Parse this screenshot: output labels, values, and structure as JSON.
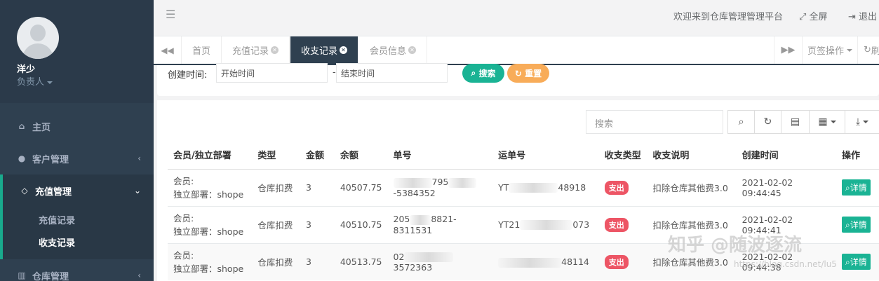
{
  "user": {
    "name": "洋少",
    "role": "负责人"
  },
  "sidebar": {
    "items": [
      {
        "label": "主页",
        "icon": "home-icon"
      },
      {
        "label": "客户管理",
        "icon": "user-icon"
      },
      {
        "label": "充值管理",
        "icon": "diamond-icon"
      },
      {
        "label": "仓库管理",
        "icon": "bank-icon"
      }
    ],
    "sub_items": [
      {
        "label": "充值记录"
      },
      {
        "label": "收支记录"
      }
    ]
  },
  "header": {
    "welcome": "欢迎来到仓库管理管理平台",
    "fullscreen": "全屏",
    "logout": "退出"
  },
  "tabs": [
    {
      "label": "首页"
    },
    {
      "label": "充值记录"
    },
    {
      "label": "收支记录",
      "active": true
    },
    {
      "label": "会员信息"
    }
  ],
  "tab_ops": {
    "label": "页签操作",
    "refresh": "刷"
  },
  "filter": {
    "label": "创建时间:",
    "start_placeholder": "开始时间",
    "end_placeholder": "结束时间",
    "dash": "-",
    "search_label": "搜索",
    "reset_label": "重置"
  },
  "table": {
    "search_placeholder": "搜索",
    "columns": [
      "会员/独立部署",
      "类型",
      "金额",
      "余额",
      "单号",
      "运单号",
      "收支类型",
      "收支说明",
      "创建时间",
      "操作"
    ],
    "rows": [
      {
        "member_line1": "会员:",
        "member_line2": "独立部署：shope",
        "type": "仓库扣费",
        "amount": "3",
        "balance": "40507.75",
        "order_prefix": "",
        "order_mid": "795",
        "order_suffix": "-5384352",
        "waybill_prefix": "YT",
        "waybill_suffix": "48918",
        "flow_type": "支出",
        "desc": "扣除仓库其他费3.0",
        "created": "2021-02-02 09:44:45",
        "action": "详情"
      },
      {
        "member_line1": "会员:",
        "member_line2": "独立部署：shope",
        "type": "仓库扣费",
        "amount": "3",
        "balance": "40510.75",
        "order_prefix": "205",
        "order_mid": "8821",
        "order_suffix": "-8311531",
        "waybill_prefix": "YT21",
        "waybill_suffix": "073",
        "flow_type": "支出",
        "desc": "扣除仓库其他费3.0",
        "created": "2021-02-02 09:44:41",
        "action": "详情"
      },
      {
        "member_line1": "会员:",
        "member_line2": "独立部署：shope",
        "type": "仓库扣费",
        "amount": "3",
        "balance": "40513.75",
        "order_prefix": "02",
        "order_mid": "",
        "order_suffix": "3572363",
        "waybill_prefix": "",
        "waybill_suffix": "48114",
        "flow_type": "支出",
        "desc": "扣除仓库其他费3.0",
        "created": "2021-02-02 09:44:38",
        "action": "详情"
      }
    ]
  },
  "watermark": {
    "text": "知乎 @随波逐流",
    "url": "https://blog.csdn.net/lu5"
  },
  "colors": {
    "sidebar": "#2f4050",
    "accent": "#1ab394",
    "reset": "#f8ac59",
    "badge": "#ed5565"
  }
}
